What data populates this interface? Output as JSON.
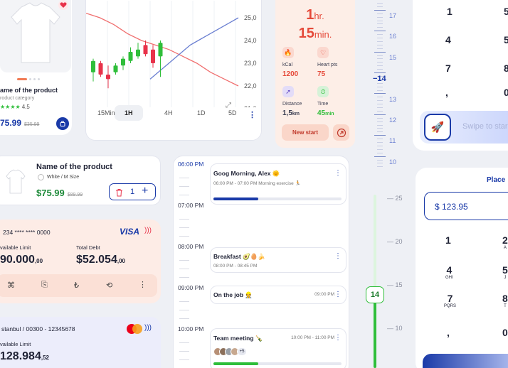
{
  "product_card": {
    "title": "ame of the product",
    "category": "roduct category",
    "stars": "★★★★",
    "rating": "4.5",
    "price": "75.99",
    "old_price": "$35.99",
    "heart_icon": "heart-icon",
    "cart_icon": "shopping-bag-icon"
  },
  "chart_card": {
    "tabs": [
      "15Min",
      "1H",
      "4H",
      "1D",
      "5D"
    ],
    "active_tab": "1H",
    "more": "⋮",
    "colors": {
      "up": "#2fbe3a",
      "down": "#e8324a",
      "ma_red": "#f06f6f",
      "ma_blue": "#6a7fd1"
    }
  },
  "chart_data": {
    "type": "candlestick",
    "y_ticks": [
      "25,0",
      "24,0",
      "23,0",
      "22,0",
      "21,0"
    ],
    "ylim": [
      21.0,
      25.0
    ],
    "candles": [
      {
        "o": 22.6,
        "h": 23.2,
        "l": 22.2,
        "c": 23.1,
        "up": true
      },
      {
        "o": 23.0,
        "h": 23.1,
        "l": 22.4,
        "c": 22.5,
        "up": false
      },
      {
        "o": 22.5,
        "h": 22.9,
        "l": 21.9,
        "c": 22.3,
        "up": false
      },
      {
        "o": 22.6,
        "h": 23.0,
        "l": 22.5,
        "c": 22.9,
        "up": true
      },
      {
        "o": 22.9,
        "h": 23.3,
        "l": 22.7,
        "c": 23.2,
        "up": true
      },
      {
        "o": 23.1,
        "h": 23.7,
        "l": 23.0,
        "c": 23.5,
        "up": true
      },
      {
        "o": 23.3,
        "h": 23.9,
        "l": 23.2,
        "c": 23.6,
        "up": true
      },
      {
        "o": 23.8,
        "h": 24.0,
        "l": 23.3,
        "c": 23.4,
        "up": false
      },
      {
        "o": 23.6,
        "h": 23.8,
        "l": 22.8,
        "c": 23.0,
        "up": false
      },
      {
        "o": 23.3,
        "h": 24.0,
        "l": 22.4,
        "c": 23.9,
        "up": true
      }
    ],
    "ma_red": [
      25.2,
      25.0,
      24.7,
      24.3,
      24.0,
      23.8,
      23.6,
      23.3,
      23.0,
      22.6,
      22.3,
      22.0
    ],
    "ma_blue": [
      22.3,
      22.6,
      22.9,
      23.2,
      23.5,
      23.8,
      24.0,
      24.2,
      24.4,
      24.6,
      24.8,
      25.0
    ]
  },
  "workout": {
    "hours": "1",
    "hours_unit": "hr.",
    "mins": "15",
    "mins_unit": "min.",
    "kcal_label": "kCal",
    "kcal": "1200",
    "heart_label": "Heart pts",
    "heart": "75",
    "distance_label": "Distance",
    "distance": "1,5",
    "distance_unit": "km",
    "time_label": "Time",
    "time": "45",
    "time_unit": "min",
    "new_start": "New start"
  },
  "ruler": {
    "labels": [
      "17",
      "16",
      "15",
      "14",
      "13",
      "12",
      "11",
      "10"
    ],
    "selected": "14"
  },
  "keypad_top": {
    "keys": [
      "1",
      "5",
      "4",
      "5",
      "7",
      "8",
      ",",
      "0"
    ],
    "swipe_text": "Swipe to star"
  },
  "cart": {
    "title": "Name of the product",
    "variant": "White / M Size",
    "price": "$75.99",
    "old_price": "$89.99",
    "qty": "1",
    "minus": "−",
    "plus": "+"
  },
  "visa": {
    "number": "234 **** **** 0000",
    "brand": "VISA",
    "limit_label": "vailable Limit",
    "limit": "90.000",
    "limit_cents": ",00",
    "limit_prefix": "$",
    "debt_label": "Total Debt",
    "debt": "$52.054",
    "debt_cents": ",00"
  },
  "master": {
    "account": "stanbul / 00300 - 12345678",
    "limit_label": "vailable Limit",
    "limit": "128.984",
    "limit_cents": ",52"
  },
  "schedule": {
    "times": [
      "06:00 PM",
      "07:00 PM",
      "08:00 PM",
      "09:00 PM",
      "10:00 PM"
    ],
    "events": [
      {
        "title": "Goog Morning, Alex 🌞",
        "sub": "06:00 PM - 07:00 PM Morning exercise 🏃",
        "progress": 0.35
      },
      {
        "title": "Breakfast 🥑🥚🍌",
        "sub": "08:00 PM - 08:45 PM"
      },
      {
        "title": "On the job 👷",
        "time": "09:00 PM"
      },
      {
        "title": "Team meeting 🍾",
        "time": "10:00 PM - 11:00 PM",
        "more": "+5",
        "progress": 0.35
      }
    ]
  },
  "vslider": {
    "labels": [
      "25",
      "20",
      "15",
      "10"
    ],
    "value": "14",
    "fill": 0.3
  },
  "keypad_bottom": {
    "title": "Place",
    "amount": "$ 123.95",
    "keys": [
      {
        "n": "1",
        "l": ""
      },
      {
        "n": "2",
        "l": "A"
      },
      {
        "n": "4",
        "l": "GHI"
      },
      {
        "n": "5",
        "l": "J"
      },
      {
        "n": "7",
        "l": "PQRS"
      },
      {
        "n": "8",
        "l": "T"
      },
      {
        "n": ",",
        "l": ""
      },
      {
        "n": "0",
        "l": ""
      }
    ]
  }
}
